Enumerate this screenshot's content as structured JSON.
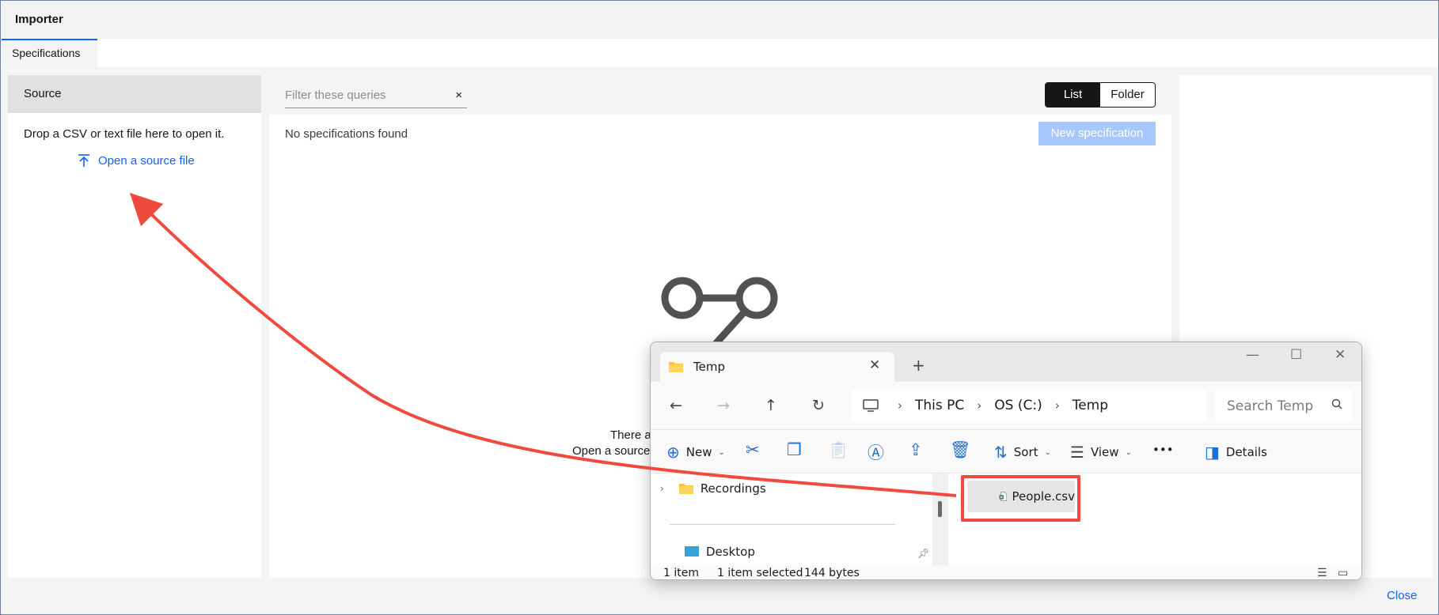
{
  "app": {
    "title": "Importer",
    "tab": "Specifications"
  },
  "source": {
    "header": "Source",
    "drop_text": "Drop a CSV or text file here to open it.",
    "open_link": "Open a source file"
  },
  "main": {
    "filter_placeholder": "Filter these queries",
    "clear_glyph": "×",
    "view_list": "List",
    "view_folder": "Folder",
    "no_specs": "No specifications found",
    "new_spec": "New specification",
    "empty_line1": "There a",
    "empty_line2": "Open a source"
  },
  "footer": {
    "close": "Close"
  },
  "explorer": {
    "tab_title": "Temp",
    "newtab_glyph": "+",
    "tab_close_glyph": "✕",
    "win_min": "—",
    "win_max": "☐",
    "win_close": "✕",
    "nav_back": "←",
    "nav_forward": "→",
    "nav_up": "↑",
    "nav_refresh": "↻",
    "breadcrumb": [
      "This PC",
      "OS (C:)",
      "Temp"
    ],
    "breadcrumb_sep": "›",
    "search_placeholder": "Search Temp",
    "commands": {
      "new": "New",
      "sort": "Sort",
      "view": "View",
      "more": "•••",
      "details": "Details"
    },
    "nav_items": {
      "recordings": "Recordings",
      "desktop": "Desktop"
    },
    "file": "People.csv",
    "status": {
      "count": "1 item",
      "selected": "1 item selected",
      "size": "144 bytes"
    }
  },
  "colors": {
    "accent": "#0f62fe",
    "annotation": "#f04a3e",
    "new_spec_disabled": "#a6c8ff"
  },
  "icons": [
    "upload-icon",
    "empty-state-icon",
    "folder-icon",
    "search-icon",
    "excel-file-icon"
  ]
}
